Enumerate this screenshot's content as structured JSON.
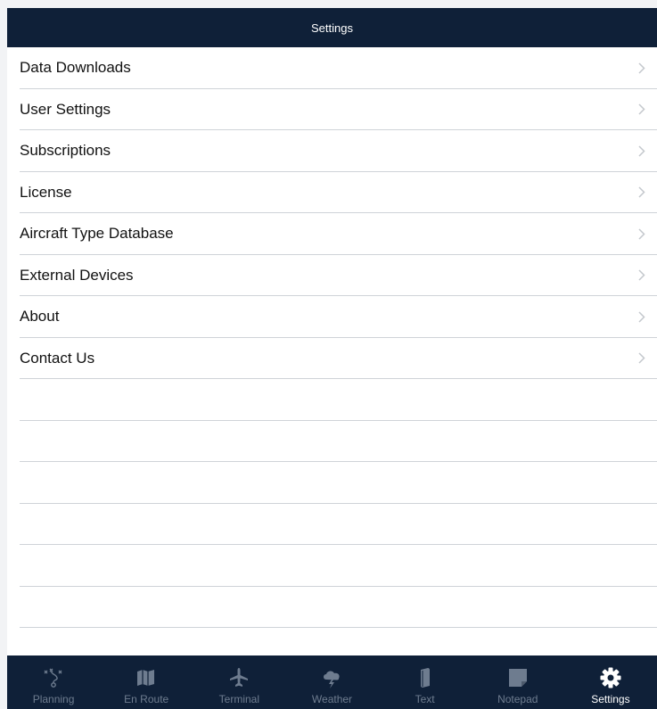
{
  "navbar": {
    "title": "Settings"
  },
  "settings": {
    "items": [
      {
        "label": "Data Downloads"
      },
      {
        "label": "User Settings"
      },
      {
        "label": "Subscriptions"
      },
      {
        "label": "License"
      },
      {
        "label": "Aircraft Type Database"
      },
      {
        "label": "External Devices"
      },
      {
        "label": "About"
      },
      {
        "label": "Contact Us"
      }
    ]
  },
  "tabbar": {
    "tabs": [
      {
        "label": "Planning",
        "icon": "planning-icon",
        "active": false
      },
      {
        "label": "En Route",
        "icon": "map-icon",
        "active": false
      },
      {
        "label": "Terminal",
        "icon": "airplane-icon",
        "active": false
      },
      {
        "label": "Weather",
        "icon": "storm-cloud-icon",
        "active": false
      },
      {
        "label": "Text",
        "icon": "book-icon",
        "active": false
      },
      {
        "label": "Notepad",
        "icon": "notepad-icon",
        "active": false
      },
      {
        "label": "Settings",
        "icon": "gear-icon",
        "active": true
      }
    ]
  },
  "colors": {
    "nav_background": "#0f2038",
    "inactive_tab": "#6e7c8f",
    "active_tab": "#ffffff",
    "separator": "#cfd3d8",
    "chevron": "#c4c8cd"
  }
}
